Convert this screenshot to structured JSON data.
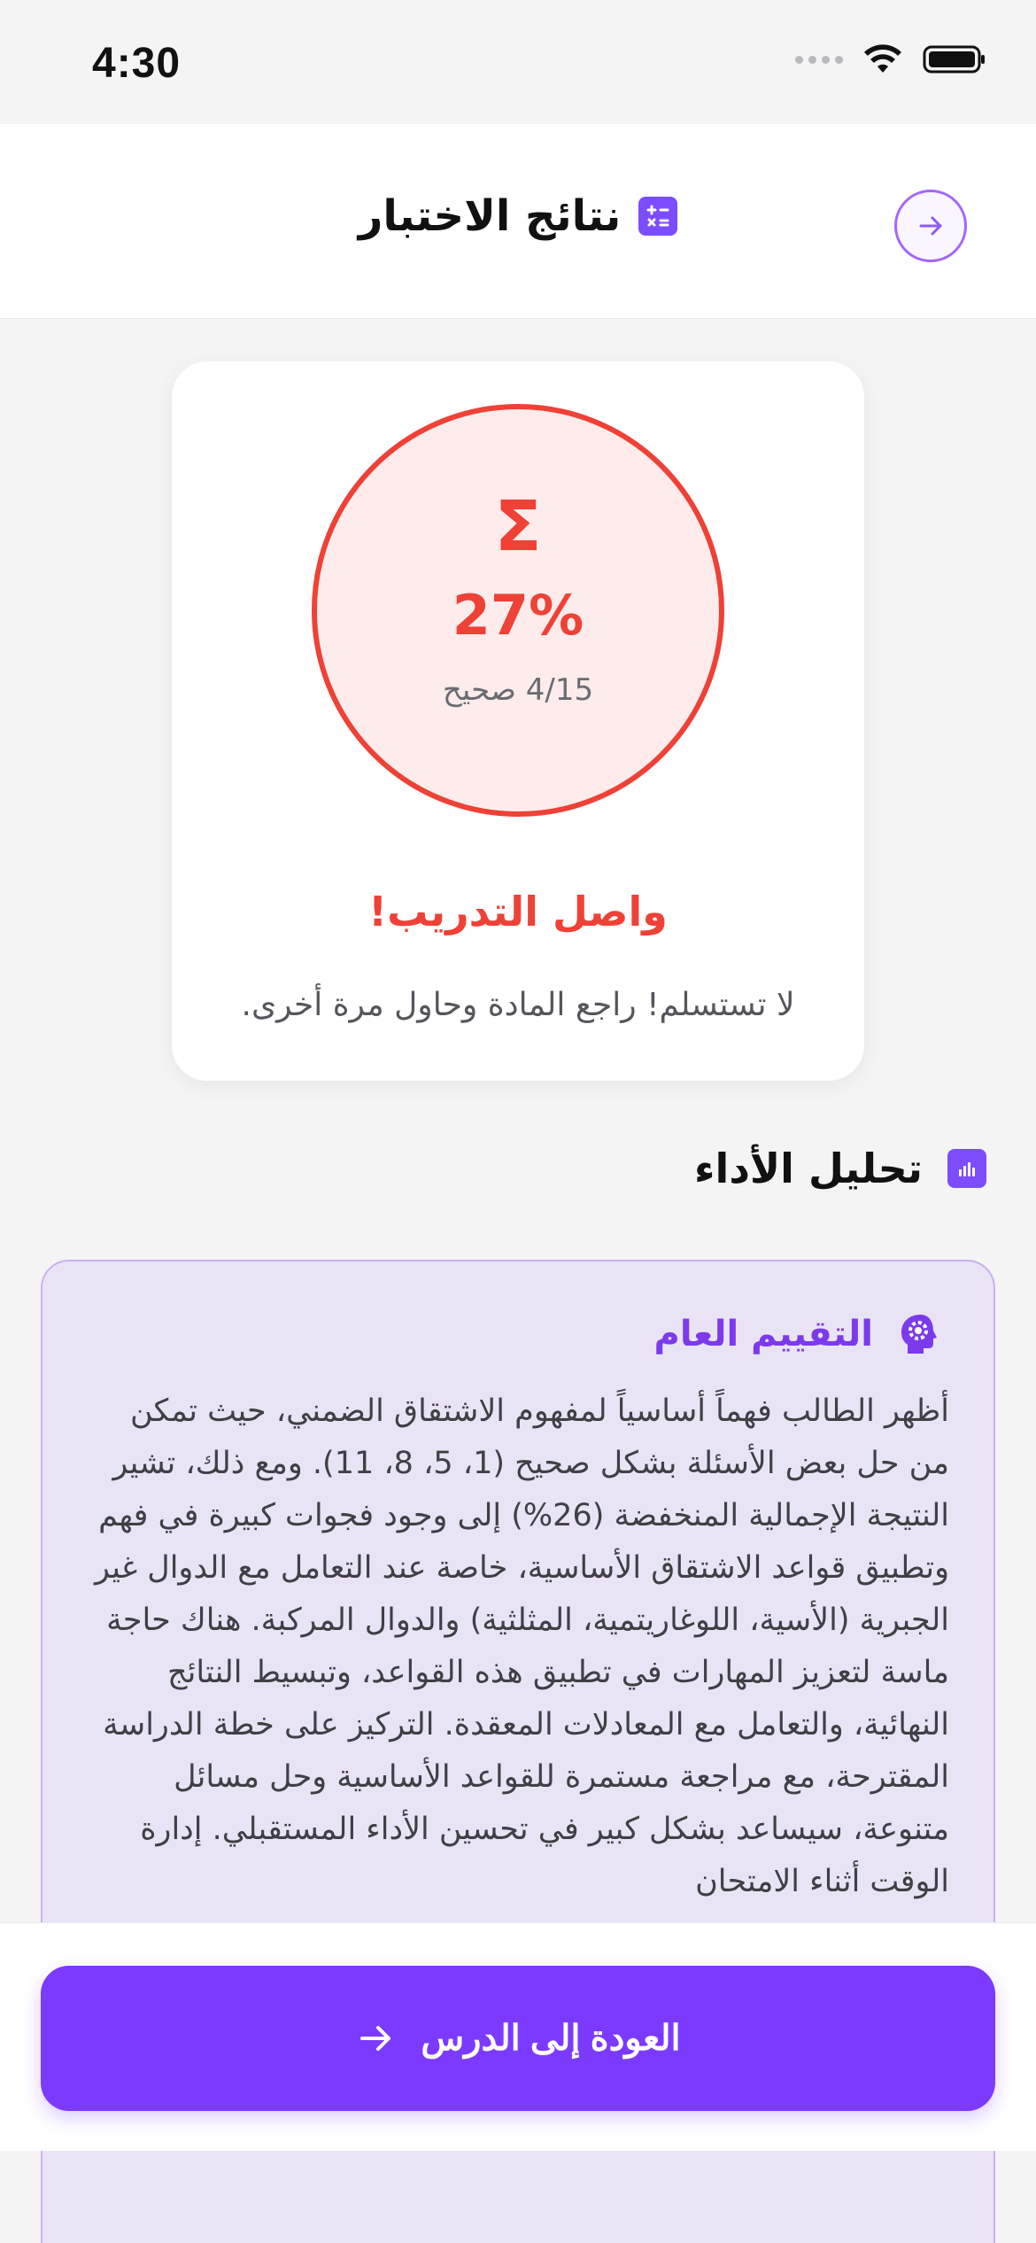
{
  "status_bar": {
    "time": "4:30"
  },
  "header": {
    "title": "نتائج الاختبار"
  },
  "score": {
    "glyph": "Ʃ",
    "percent": "27%",
    "count": "4/15 صحيح",
    "headline": "واصل التدريب!",
    "message": "لا تستسلم! راجع المادة وحاول مرة أخرى."
  },
  "analysis": {
    "section_title": "تحليل الأداء",
    "card_title": "التقييم العام",
    "body": "أظهر الطالب فهماً أساسياً لمفهوم الاشتقاق الضمني، حيث تمكن من حل بعض الأسئلة بشكل صحيح (1، 5، 8، 11). ومع ذلك، تشير النتيجة الإجمالية المنخفضة (26%) إلى وجود فجوات كبيرة في فهم وتطبيق قواعد الاشتقاق الأساسية، خاصة عند التعامل مع الدوال غير الجبرية (الأسية، اللوغاريتمية، المثلثية) والدوال المركبة. هناك حاجة ماسة لتعزيز المهارات في تطبيق هذه القواعد، وتبسيط النتائج النهائية، والتعامل مع المعادلات المعقدة. التركيز على خطة الدراسة المقترحة، مع مراجعة مستمرة للقواعد الأساسية وحل مسائل متنوعة، سيساعد بشكل كبير في تحسين الأداء المستقبلي. إدارة الوقت أثناء الامتحان"
  },
  "footer": {
    "button_label": "العودة إلى الدرس"
  },
  "colors": {
    "accent": "#7c3aff",
    "fail": "#ef4136",
    "fail_bg": "#fdeceb",
    "analysis_bg": "#e9e4f5"
  },
  "icons": {
    "back": "arrow-right-icon",
    "header": "calculator-icon",
    "section": "bar-chart-icon",
    "card": "brain-gear-icon",
    "button": "arrow-right-icon"
  }
}
